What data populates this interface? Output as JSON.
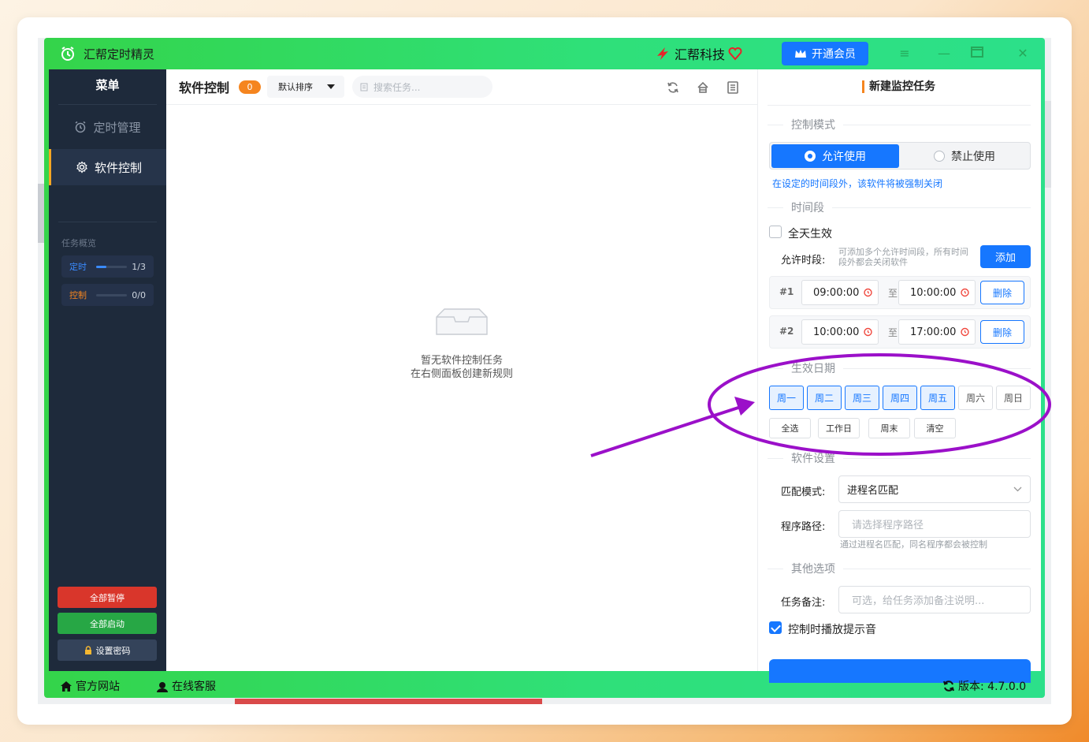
{
  "window": {
    "app_title": "汇帮定时精灵",
    "brand": "汇帮科技",
    "vip_label": "开通会员"
  },
  "sidebar": {
    "menu_title": "菜单",
    "items": [
      {
        "label": "定时管理",
        "icon": "alarm-clock-icon",
        "active": false
      },
      {
        "label": "软件控制",
        "icon": "gear-icon",
        "active": true
      }
    ],
    "overview_title": "任务概览",
    "overview": [
      {
        "name": "定时",
        "value": "1/3",
        "progress": 0.33,
        "color": "#3a8bff"
      },
      {
        "name": "控制",
        "value": "0/0",
        "progress": 0,
        "color": "#f5851f"
      }
    ],
    "pause_all": "全部暂停",
    "start_all": "全部启动",
    "set_password": "设置密码"
  },
  "center": {
    "title": "软件控制",
    "count": "0",
    "sort_label": "默认排序",
    "search_placeholder": "搜索任务...",
    "empty_line1": "暂无软件控制任务",
    "empty_line2": "在右侧面板创建新规则"
  },
  "panel": {
    "title": "新建监控任务",
    "control_mode_label": "控制模式",
    "mode_allow": "允许使用",
    "mode_forbid": "禁止使用",
    "mode_hint": "在设定的时间段外，该软件将被强制关闭",
    "time_label": "时间段",
    "all_day": "全天生效",
    "allow_period_label": "允许时段:",
    "allow_period_hint": "可添加多个允许时间段，所有时间段外都会关闭软件",
    "add_label": "添加",
    "slots": [
      {
        "no": "#1",
        "start": "09:00:00",
        "end": "10:00:00"
      },
      {
        "no": "#2",
        "start": "10:00:00",
        "end": "17:00:00"
      }
    ],
    "to_label": "至",
    "delete_label": "删除",
    "date_label": "生效日期",
    "days": [
      {
        "label": "周一",
        "on": true
      },
      {
        "label": "周二",
        "on": true
      },
      {
        "label": "周三",
        "on": true
      },
      {
        "label": "周四",
        "on": true
      },
      {
        "label": "周五",
        "on": true
      },
      {
        "label": "周六",
        "on": false
      },
      {
        "label": "周日",
        "on": false
      }
    ],
    "quick": [
      "全选",
      "工作日",
      "周末",
      "清空"
    ],
    "software_label": "软件设置",
    "match_mode_label": "匹配模式:",
    "match_mode_value": "进程名匹配",
    "path_label": "程序路径:",
    "path_placeholder": "请选择程序路径",
    "path_hint": "通过进程名匹配，同名程序都会被控制",
    "other_label": "其他选项",
    "note_label": "任务备注:",
    "note_placeholder": "可选，给任务添加备注说明...",
    "sound_label": "控制时播放提示音",
    "sound_checked": true
  },
  "footer": {
    "website": "官方网站",
    "support": "在线客服",
    "version": "版本: 4.7.0.0"
  },
  "colors": {
    "accent": "#1677ff",
    "titlebar_green": "#34d44a",
    "sidebar_bg": "#1e2a3b",
    "annotation": "#9b10c9"
  }
}
